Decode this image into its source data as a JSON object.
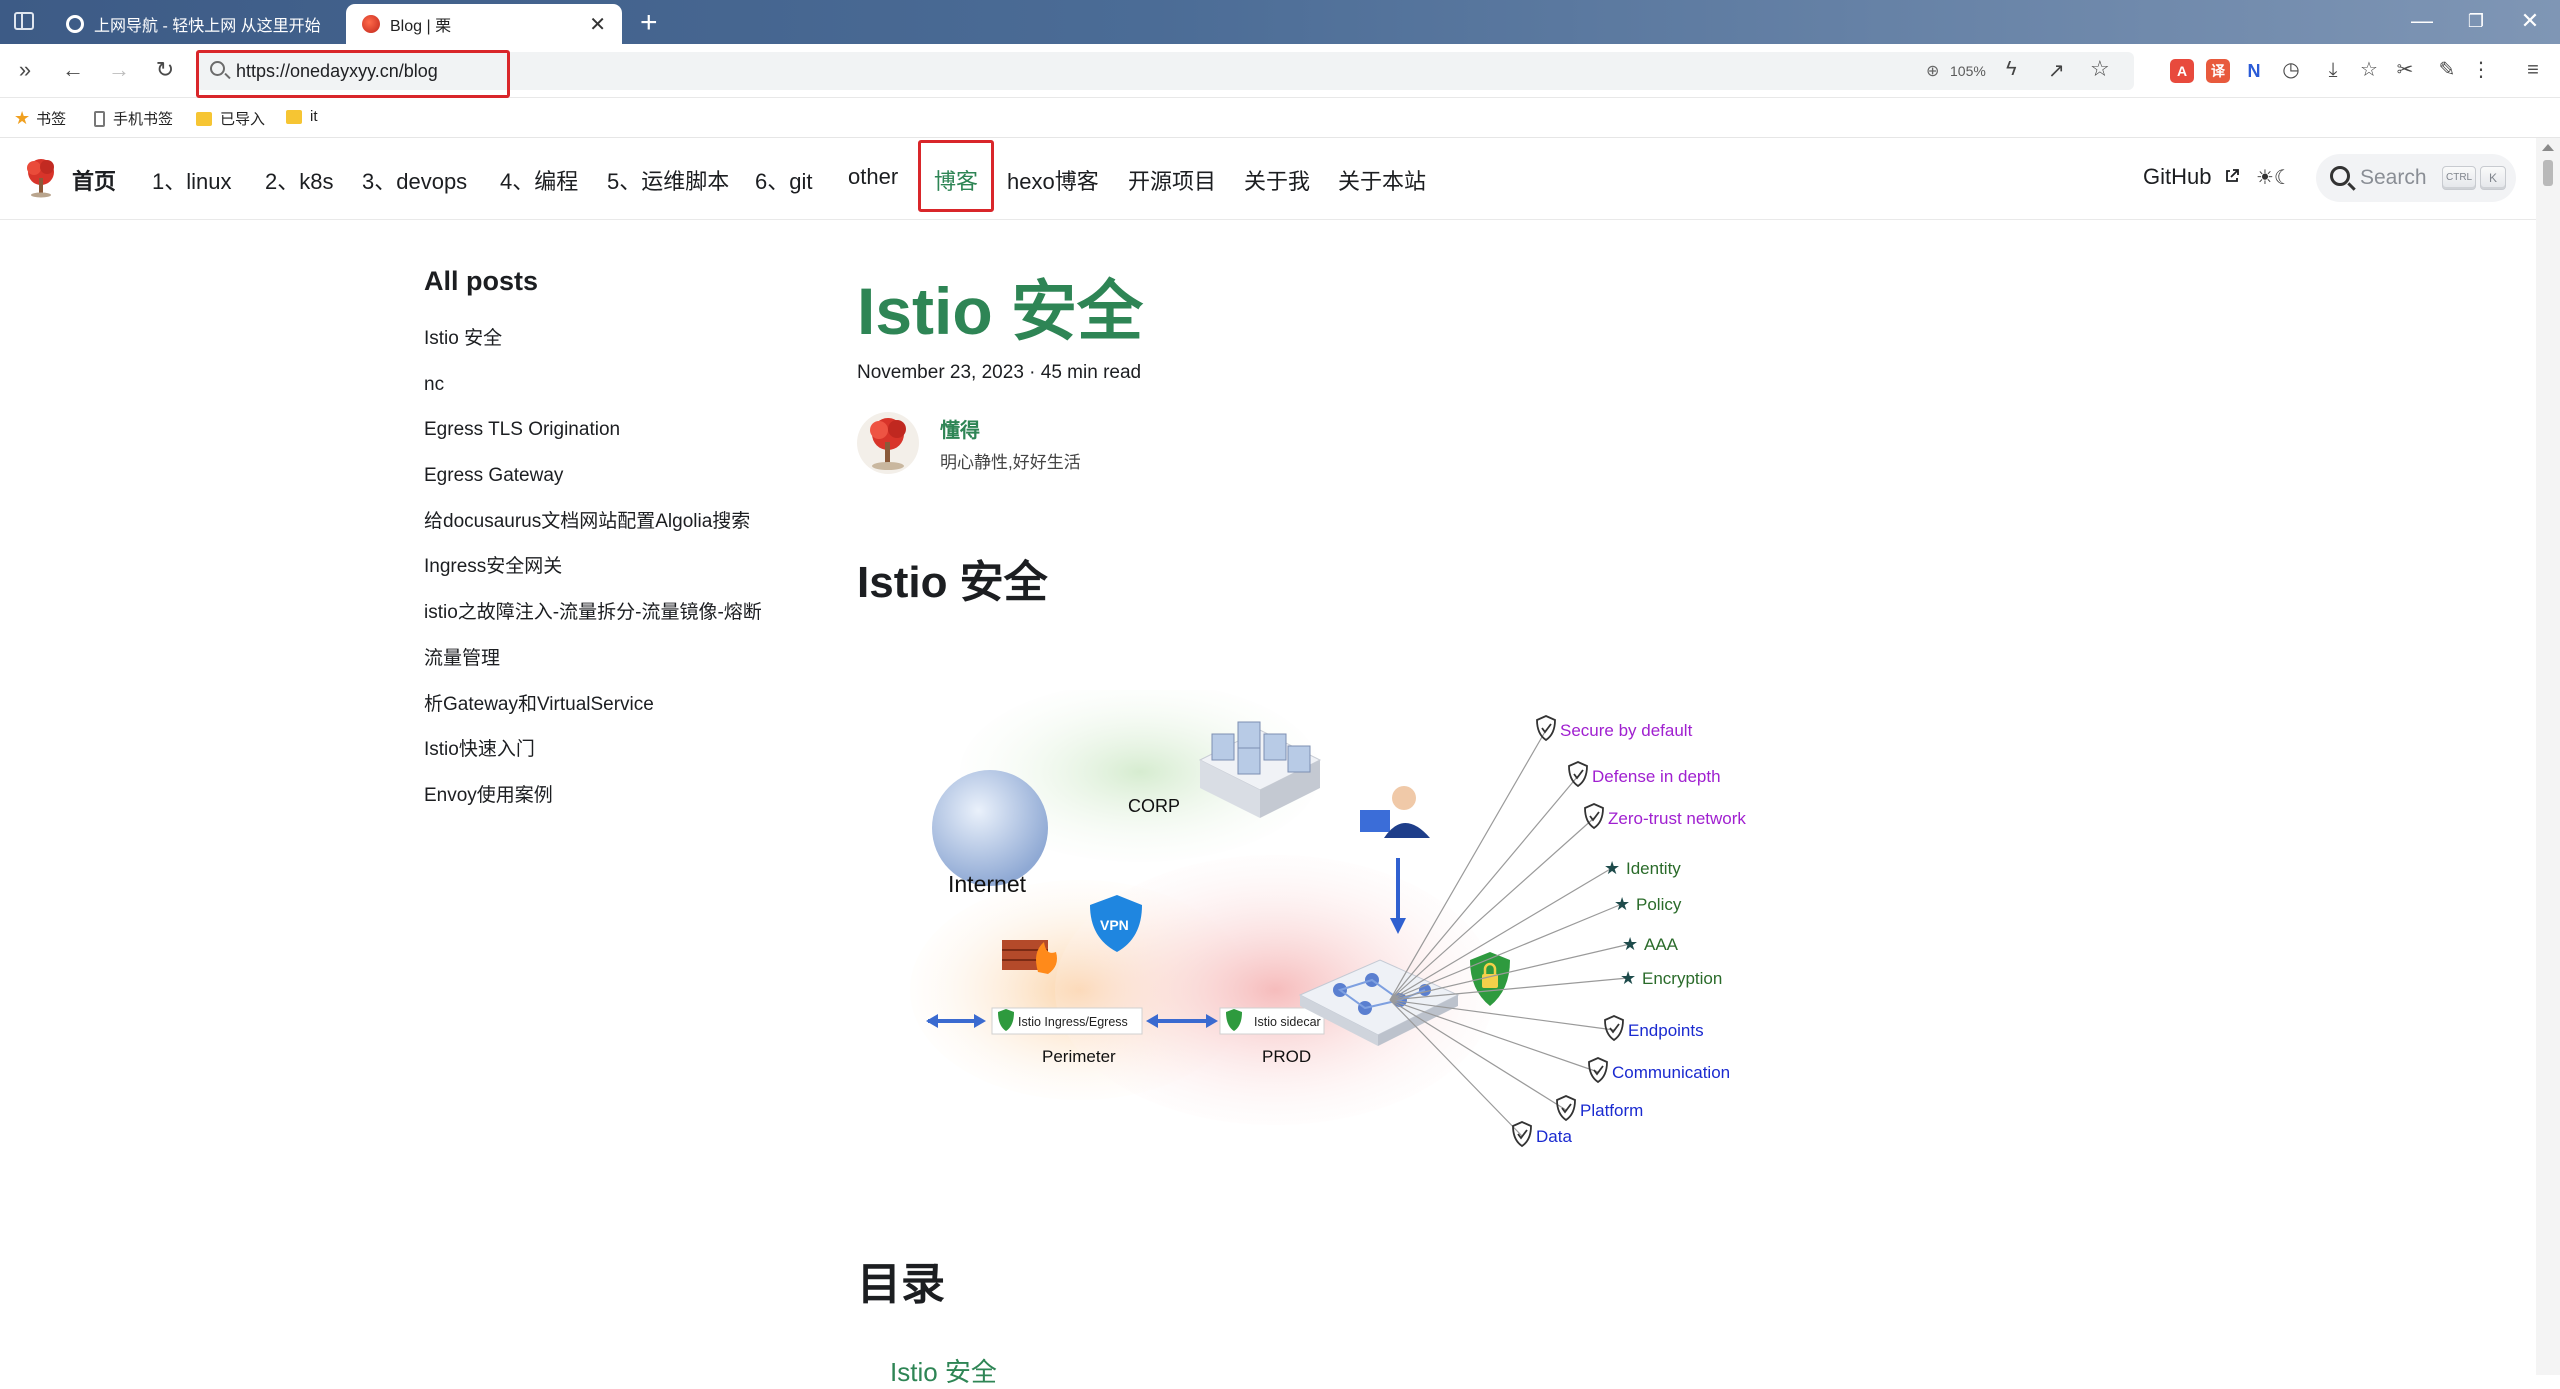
{
  "browser": {
    "tabs": [
      {
        "title": "上网导航 - 轻快上网 从这里开始",
        "active": false
      },
      {
        "title": "Blog | 栗",
        "active": true
      }
    ],
    "address": "https://onedayxyy.cn/blog",
    "zoom": "105%"
  },
  "bookmarks": [
    {
      "label": "书签",
      "icon": "star-icon"
    },
    {
      "label": "手机书签",
      "icon": "phone-icon"
    },
    {
      "label": "已导入",
      "icon": "folder-icon"
    },
    {
      "label": "it",
      "icon": "folder-icon"
    }
  ],
  "site_nav": {
    "brand": "首页",
    "items": [
      "1、linux",
      "2、k8s",
      "3、devops",
      "4、编程",
      "5、运维脚本",
      "6、git",
      "other",
      "博客",
      "hexo博客",
      "开源项目",
      "关于我",
      "关于本站"
    ],
    "active_item": "博客",
    "github": "GitHub",
    "search_placeholder": "Search",
    "search_keys": [
      "CTRL",
      "K"
    ]
  },
  "sidebar": {
    "title": "All posts",
    "posts": [
      "Istio 安全",
      "nc",
      "Egress TLS Origination",
      "Egress Gateway",
      "给docusaurus文档网站配置Algolia搜索",
      "Ingress安全网关",
      "istio之故障注入-流量拆分-流量镜像-熔断",
      "流量管理",
      "析Gateway和VirtualService",
      "Istio快速入门",
      "Envoy使用案例"
    ]
  },
  "post": {
    "title": "Istio 安全",
    "meta": "November 23, 2023 · 45 min read",
    "author_name": "懂得",
    "author_bio": "明心静性,好好生活",
    "heading1": "Istio 安全",
    "heading2": "目录",
    "toc_first": "Istio 安全"
  },
  "diagram": {
    "zones": {
      "internet": "Internet",
      "corp": "CORP",
      "perimeter": "Perimeter",
      "prod": "PROD",
      "vpn": "VPN"
    },
    "gateway_label": "Istio Ingress/Egress",
    "sidecar_label": "Istio sidecar",
    "principles": [
      "Secure by default",
      "Defense in depth",
      "Zero-trust network"
    ],
    "features": [
      "Identity",
      "Policy",
      "AAA",
      "Encryption"
    ],
    "scopes": [
      "Endpoints",
      "Communication",
      "Platform",
      "Data"
    ],
    "colors": {
      "principles": "#a020d0",
      "features": "#2a6b2a",
      "scopes": "#1a2ad0"
    }
  }
}
